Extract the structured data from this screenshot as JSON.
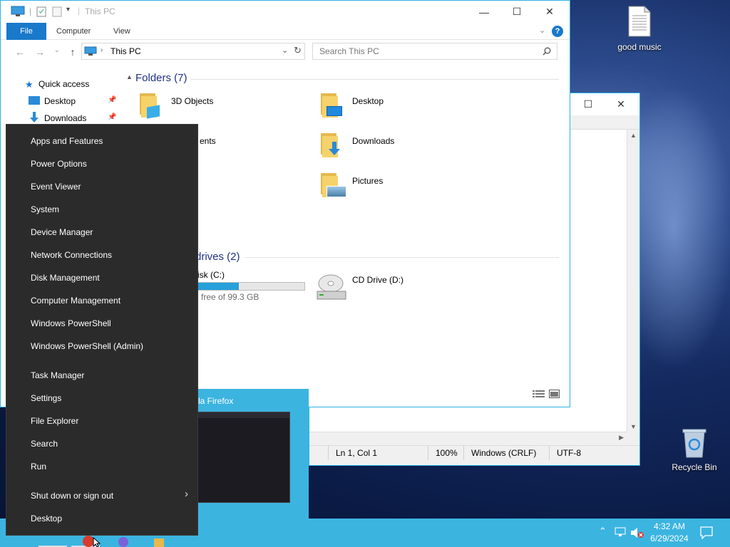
{
  "desktop": {
    "icons": [
      {
        "label": "good music",
        "icon": "text-file-icon"
      },
      {
        "label": "Recycle Bin",
        "icon": "recycle-bin-icon"
      }
    ]
  },
  "explorer": {
    "title": "This PC",
    "ribbon_tabs": [
      "File",
      "Computer",
      "View"
    ],
    "address": "This PC",
    "search_placeholder": "Search This PC",
    "nav": {
      "quick_access": "Quick access",
      "items": [
        "Desktop",
        "Downloads"
      ]
    },
    "folders_header": "Folders (7)",
    "folders": [
      "3D Objects",
      "Desktop",
      "ents",
      "Downloads",
      "Pictures"
    ],
    "drives_header": "drives (2)",
    "drives": [
      {
        "name": "isk (C:)",
        "free": "free of 99.3 GB",
        "used_fraction": 0.38
      },
      {
        "name": "CD Drive (D:)"
      }
    ]
  },
  "notepad": {
    "status": {
      "position": "Ln 1, Col 1",
      "zoom": "100%",
      "line_ending": "Windows (CRLF)",
      "encoding": "UTF-8"
    }
  },
  "taskbar_preview": {
    "title": "la Firefox"
  },
  "winx_menu": {
    "items": [
      "Apps and Features",
      "Power Options",
      "Event Viewer",
      "System",
      "Device Manager",
      "Network Connections",
      "Disk Management",
      "Computer Management",
      "Windows PowerShell",
      "Windows PowerShell (Admin)",
      "Task Manager",
      "Settings",
      "File Explorer",
      "Search",
      "Run",
      "Shut down or sign out",
      "Desktop"
    ]
  },
  "clock": {
    "time": "4:32 AM",
    "date": "6/29/2024"
  },
  "colors": {
    "accent": "#3cb4e0",
    "menu_bg": "#2b2b2b",
    "file_tab": "#1979ca"
  }
}
